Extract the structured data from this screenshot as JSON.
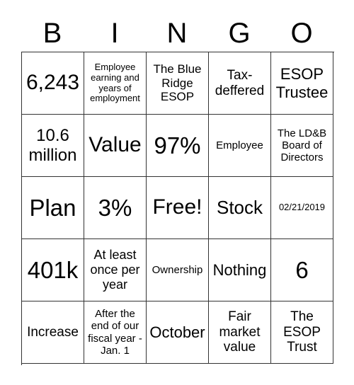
{
  "header": {
    "letters": [
      "B",
      "I",
      "N",
      "G",
      "O"
    ]
  },
  "board": {
    "rows": [
      [
        "6,243",
        "Employee earning and years of employment",
        "The Blue Ridge ESOP",
        "Tax-deffered",
        "ESOP Trustee"
      ],
      [
        "10.6 million",
        "Value",
        "97%",
        "Employee",
        "The LD&B Board of Directors"
      ],
      [
        "Plan",
        "3%",
        "Free!",
        "Stock",
        "02/21/2019"
      ],
      [
        "401k",
        "At least once per year",
        "Ownership",
        "Nothing",
        "6"
      ],
      [
        "Increase",
        "After the end of our fiscal year - Jan. 1",
        "October",
        "Fair market value",
        "The ESOP Trust"
      ]
    ]
  }
}
